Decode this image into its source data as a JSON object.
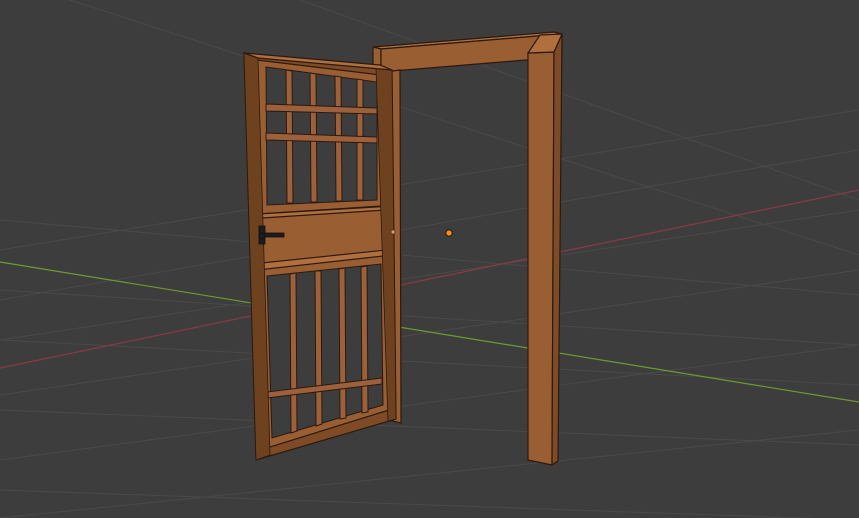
{
  "viewport": {
    "background": "#3d3d3d",
    "grid_color": "#4a4a4a",
    "x_axis_color": "#8a3a46",
    "y_axis_color": "#6f9a2e"
  },
  "objects": {
    "door_frame": {
      "color": "#9a5e33",
      "outline": "#2b1a10"
    },
    "door_leaf": {
      "color": "#9a5e33",
      "bars_upper_vertical": 4,
      "bars_upper_horizontal": 2,
      "bars_lower_vertical": 4,
      "bars_lower_horizontal": 1
    },
    "handle": {
      "color": "#1d1d1d"
    },
    "origin": {
      "color": "#ff8a1a"
    }
  }
}
